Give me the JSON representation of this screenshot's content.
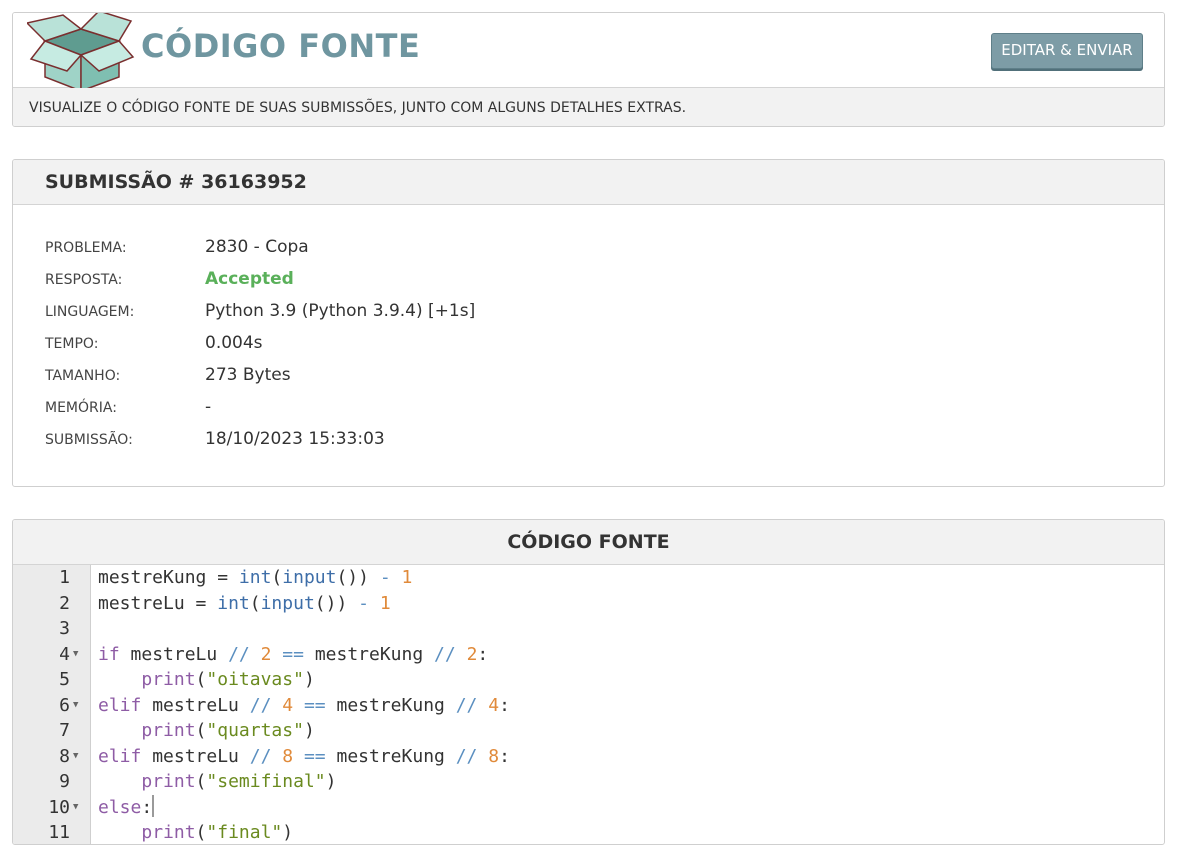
{
  "colors": {
    "title": "#6f96a0",
    "button": "#7d9ca6",
    "accepted": "#5ab05a",
    "panel_header": "#f2f2f2",
    "gutter": "#ebebeb"
  },
  "header": {
    "logo_icon": "open-box-icon",
    "title": "CÓDIGO FONTE",
    "edit_button": "EDITAR & ENVIAR",
    "description": "VISUALIZE O CÓDIGO FONTE DE SUAS SUBMISSÕES, JUNTO COM ALGUNS DETALHES EXTRAS."
  },
  "submission": {
    "title": "SUBMISSÃO # 36163952",
    "fields": {
      "problem": {
        "label": "PROBLEMA:",
        "value": "2830 - Copa"
      },
      "answer": {
        "label": "RESPOSTA:",
        "value": "Accepted"
      },
      "language": {
        "label": "LINGUAGEM:",
        "value": "Python 3.9 (Python 3.9.4) [+1s]"
      },
      "time": {
        "label": "TEMPO:",
        "value": "0.004s"
      },
      "size": {
        "label": "TAMANHO:",
        "value": "273 Bytes"
      },
      "memory": {
        "label": "MEMÓRIA:",
        "value": "-"
      },
      "submitted": {
        "label": "SUBMISSÃO:",
        "value": "18/10/2023 15:33:03"
      }
    }
  },
  "code": {
    "title": "CÓDIGO FONTE",
    "lines": [
      {
        "n": "1",
        "fold": false,
        "text": "mestreKung = int(input()) - 1"
      },
      {
        "n": "2",
        "fold": false,
        "text": "mestreLu = int(input()) - 1"
      },
      {
        "n": "3",
        "fold": false,
        "text": ""
      },
      {
        "n": "4",
        "fold": true,
        "text": "if mestreLu // 2 == mestreKung // 2:"
      },
      {
        "n": "5",
        "fold": false,
        "text": "    print(\"oitavas\")"
      },
      {
        "n": "6",
        "fold": true,
        "text": "elif mestreLu // 4 == mestreKung // 4:"
      },
      {
        "n": "7",
        "fold": false,
        "text": "    print(\"quartas\")"
      },
      {
        "n": "8",
        "fold": true,
        "text": "elif mestreLu // 8 == mestreKung // 8:"
      },
      {
        "n": "9",
        "fold": false,
        "text": "    print(\"semifinal\")"
      },
      {
        "n": "10",
        "fold": true,
        "text": "else:"
      },
      {
        "n": "11",
        "fold": false,
        "text": "    print(\"final\")"
      }
    ]
  }
}
